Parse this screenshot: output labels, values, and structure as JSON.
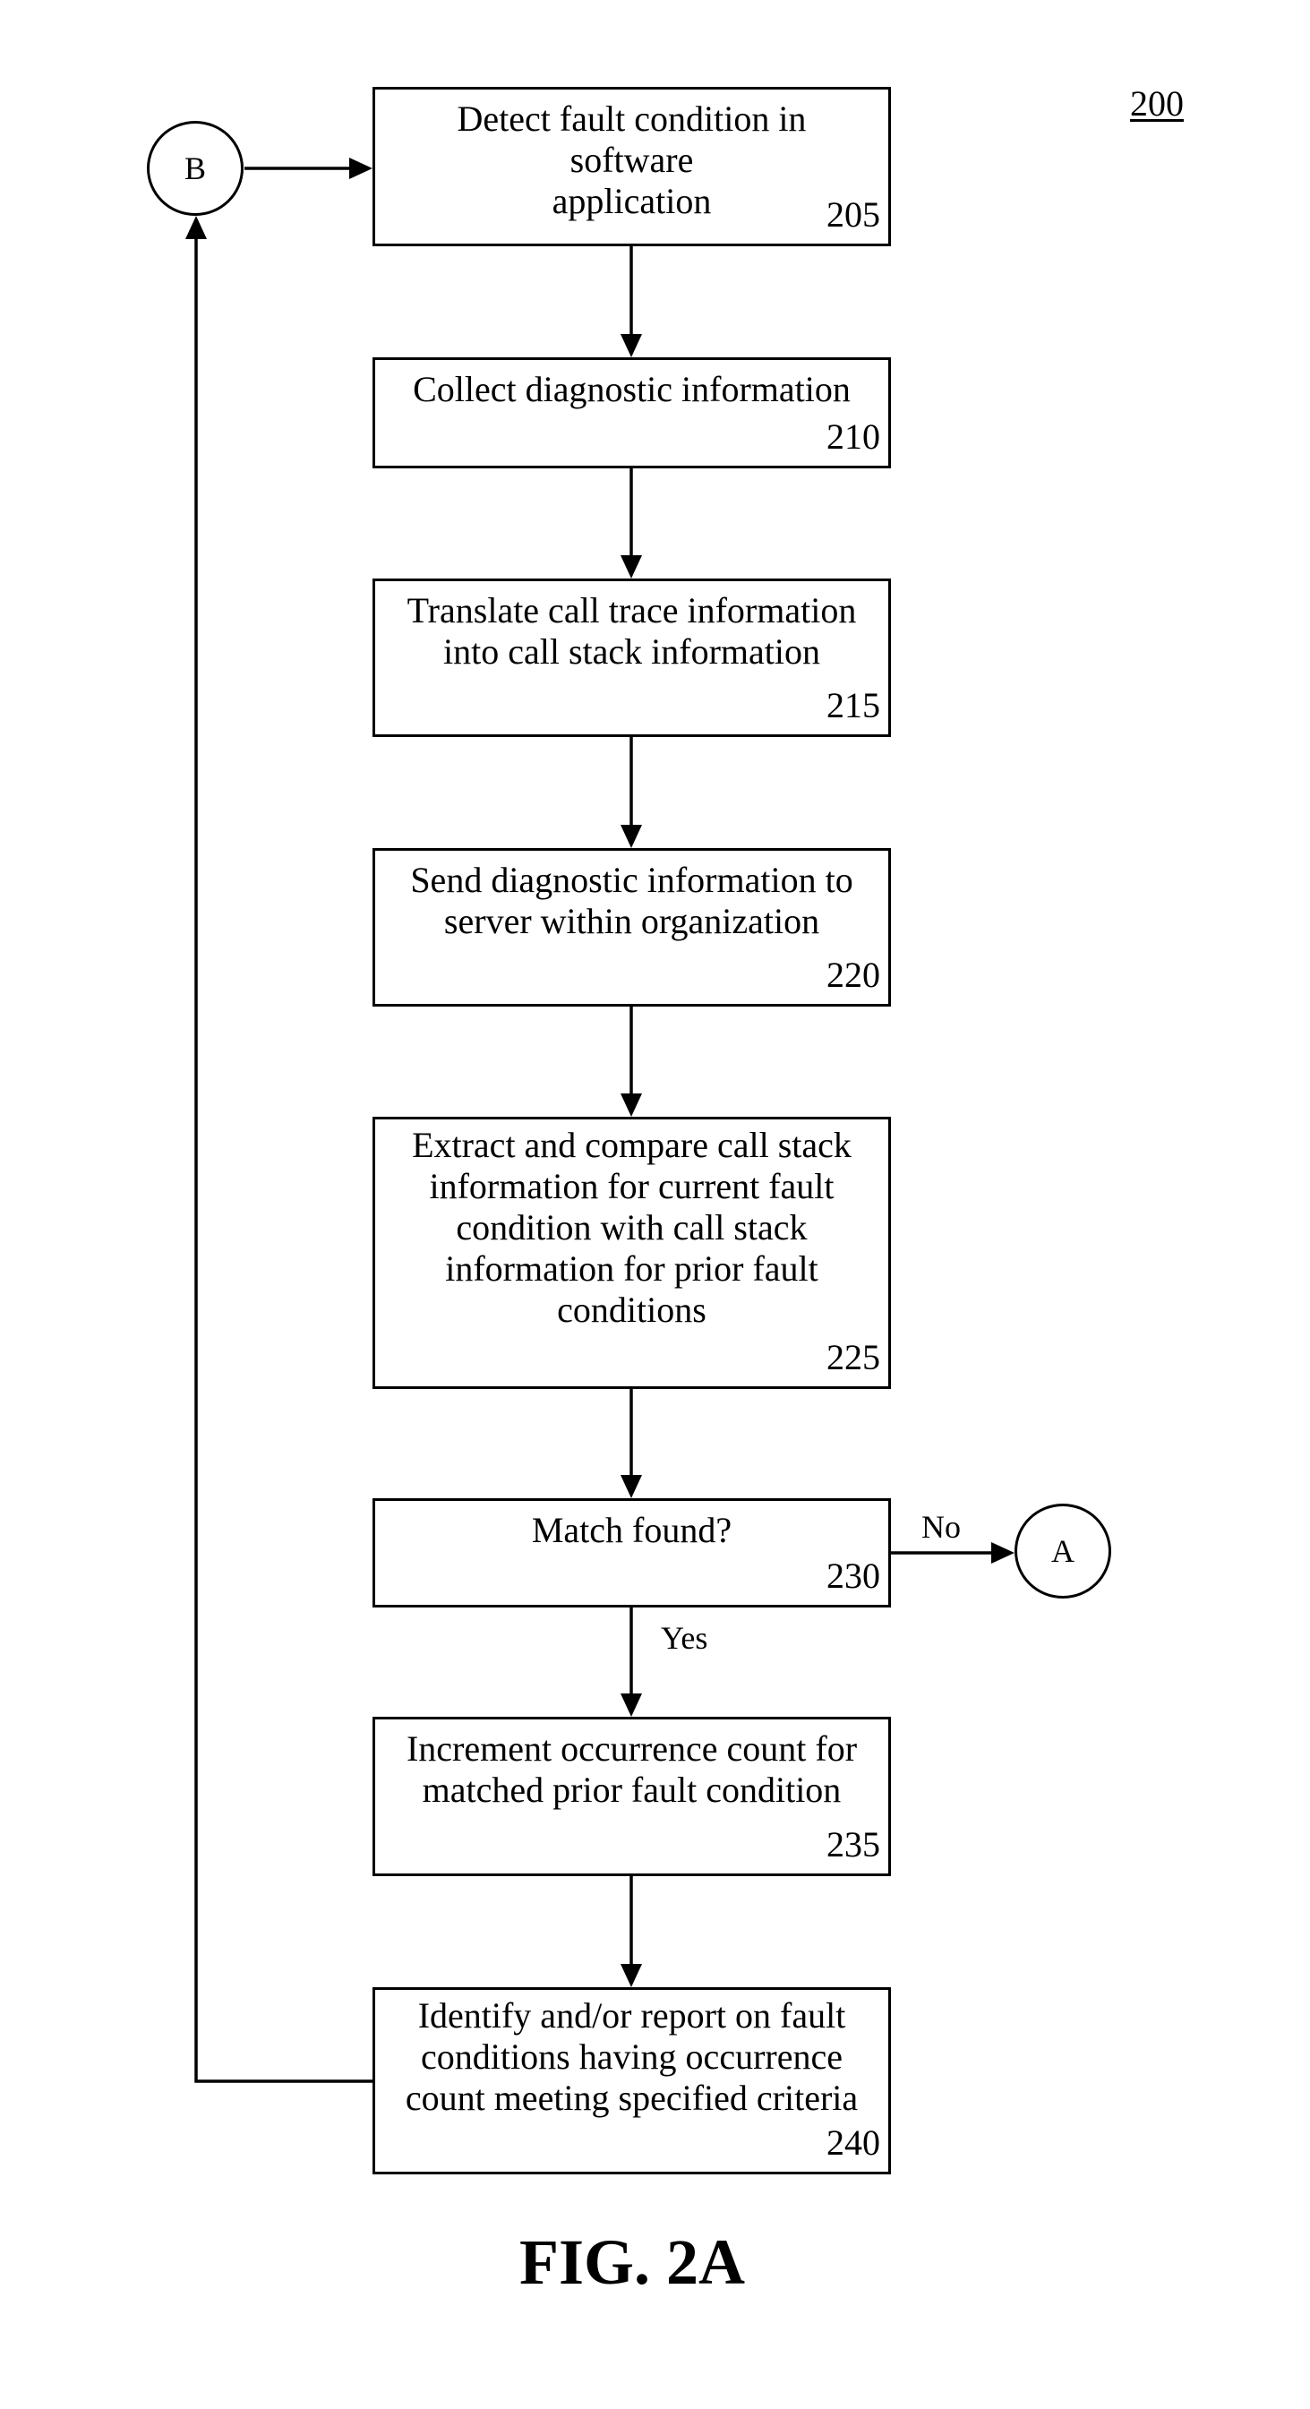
{
  "figure": {
    "reference_number": "200",
    "caption": "FIG. 2A"
  },
  "connectors": {
    "entry": {
      "label": "B"
    },
    "exit": {
      "label": "A"
    }
  },
  "steps": [
    {
      "id": "205",
      "text": "Detect fault condition in software\napplication"
    },
    {
      "id": "210",
      "text": "Collect diagnostic information"
    },
    {
      "id": "215",
      "text": "Translate call trace information\ninto call stack information"
    },
    {
      "id": "220",
      "text": "Send diagnostic information to\nserver within organization"
    },
    {
      "id": "225",
      "text": "Extract and compare call stack\ninformation for current fault\ncondition with call stack\ninformation for prior fault\nconditions"
    },
    {
      "id": "230",
      "text": "Match found?"
    },
    {
      "id": "235",
      "text": "Increment occurrence count for\nmatched prior fault condition"
    },
    {
      "id": "240",
      "text": "Identify and/or report on fault\nconditions having occurrence\ncount meeting specified criteria"
    }
  ],
  "decision": {
    "step": "230",
    "no_label": "No",
    "yes_label": "Yes",
    "no_target": "A",
    "yes_target": "235"
  },
  "flow": [
    [
      "B",
      "205"
    ],
    [
      "205",
      "210"
    ],
    [
      "210",
      "215"
    ],
    [
      "215",
      "220"
    ],
    [
      "220",
      "225"
    ],
    [
      "225",
      "230"
    ],
    [
      "230",
      "A"
    ],
    [
      "230",
      "235"
    ],
    [
      "235",
      "240"
    ],
    [
      "240",
      "B"
    ]
  ]
}
